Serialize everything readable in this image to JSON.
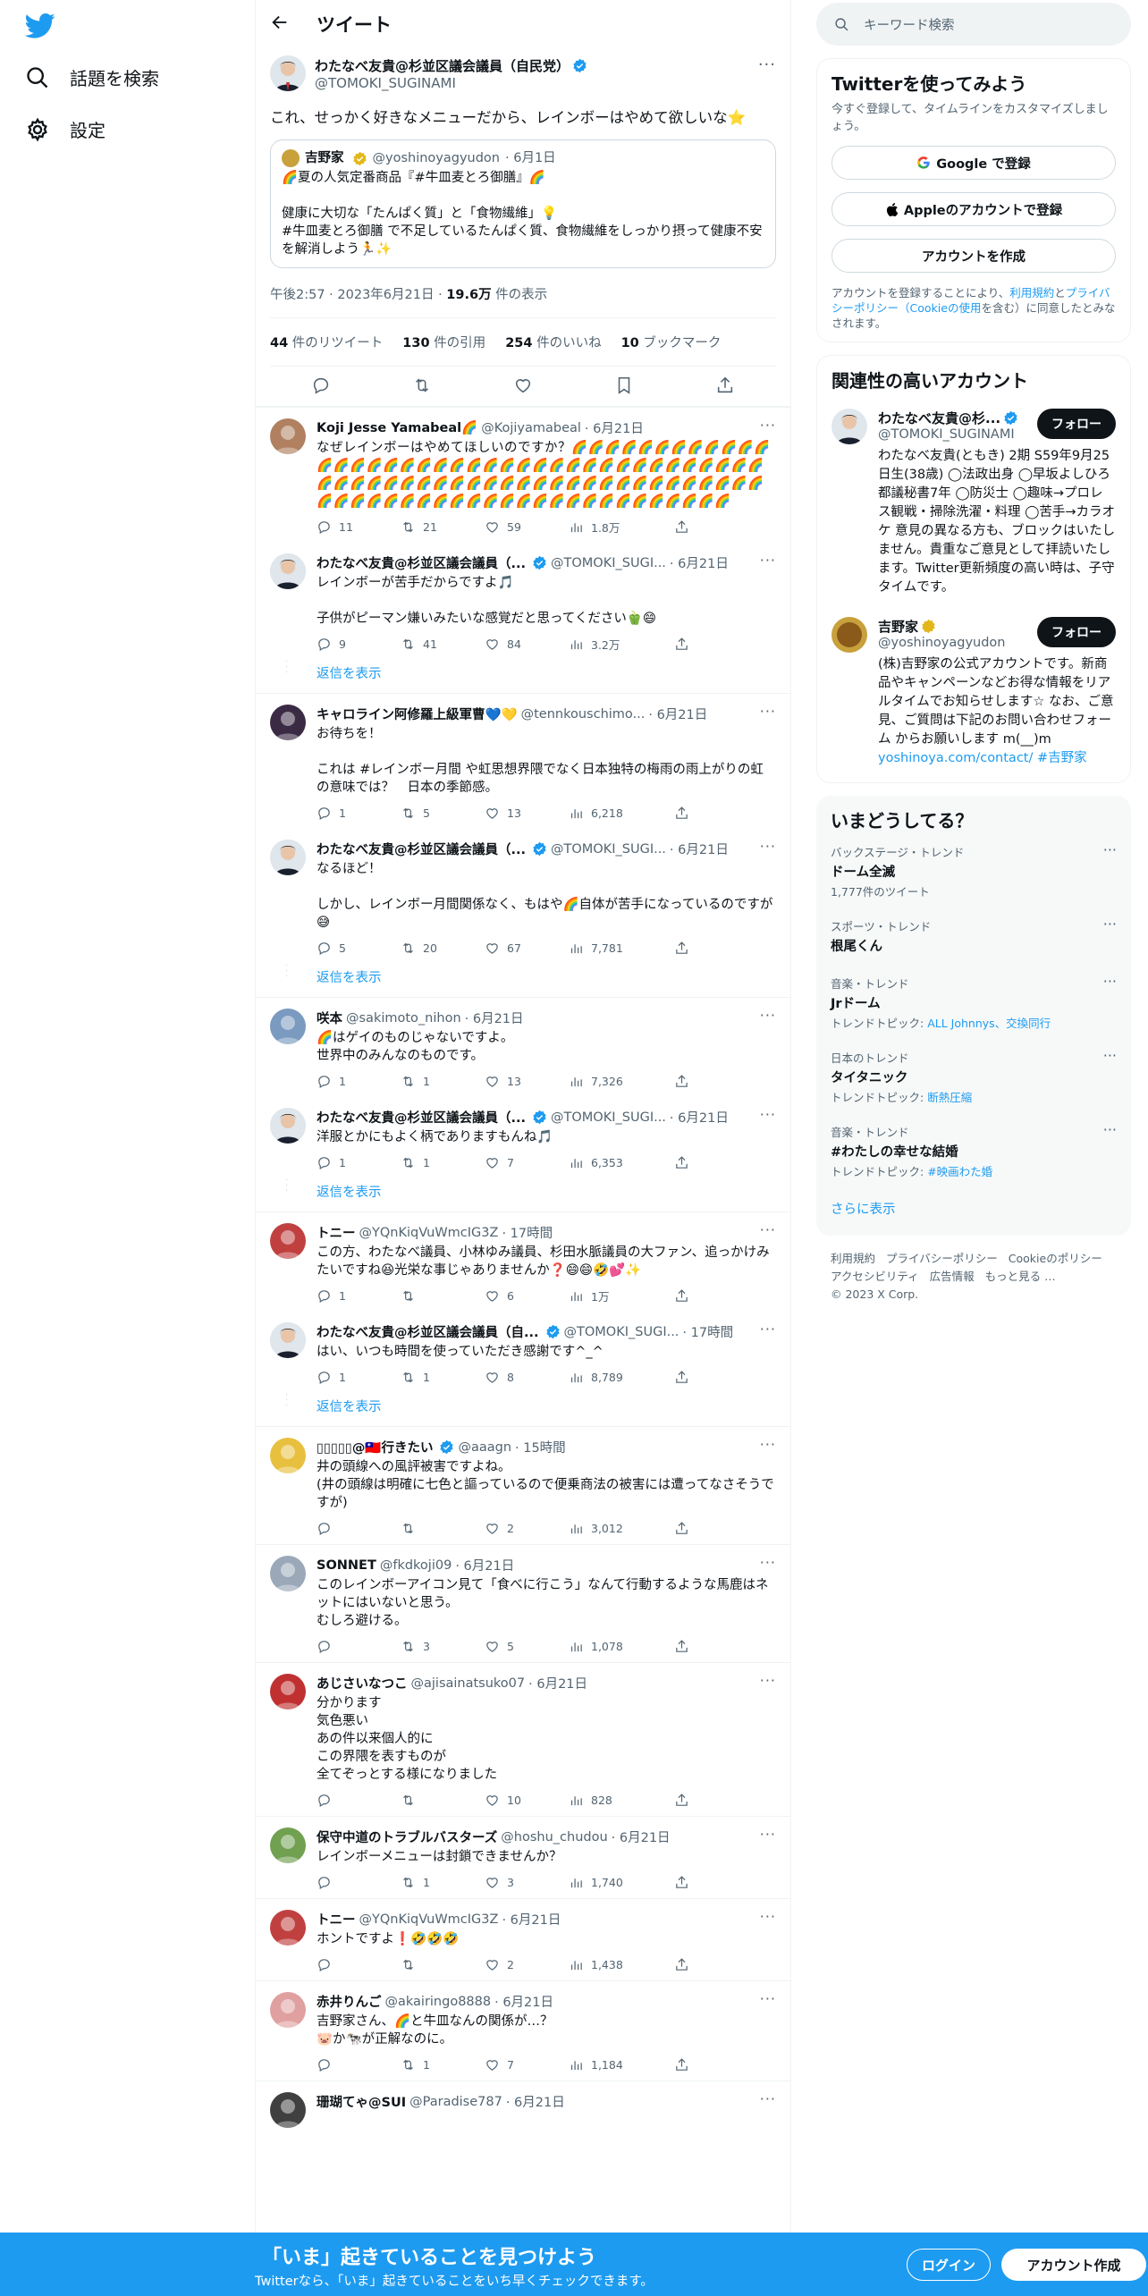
{
  "nav": {
    "explore_label": "話題を検索",
    "settings_label": "設定"
  },
  "header": {
    "title": "ツイート"
  },
  "tweet": {
    "author_name": "わたなべ友貴@杉並区議会議員（自民党）",
    "author_handle": "@TOMOKI_SUGINAMI",
    "text": "これ、せっかく好きなメニューだから、レインボーはやめて欲しいな⭐",
    "quote": {
      "author_name": "吉野家",
      "author_handle": "@yoshinoyagyudon",
      "date": "· 6月1日",
      "line1": "🌈夏の人気定番商品『#牛皿麦とろ御膳』🌈",
      "line2": "健康に大切な「たんぱく質」と「食物繊維」💡",
      "line3": "#牛皿麦とろ御膳 で不足しているたんぱく質、食物繊維をしっかり摂って健康不安を解消しよう🏃✨"
    },
    "time": "午後2:57 · 2023年6月21日 · ",
    "views": "19.6万",
    "views_label": " 件の表示",
    "stats": {
      "retweets": "44",
      "retweets_label": " 件のリツイート",
      "quotes": "130",
      "quotes_label": " 件の引用",
      "likes": "254",
      "likes_label": " 件のいいね",
      "bookmarks": "10",
      "bookmarks_label": " ブックマーク"
    }
  },
  "replies": [
    {
      "name": "Koji Jesse Yamabeal🌈",
      "handle": "@Kojiyamabeal",
      "date": "· 6月21日",
      "text": "なぜレインボーはやめてほしいのですか？🌈🌈🌈🌈🌈🌈🌈🌈🌈🌈🌈🌈🌈🌈🌈🌈🌈🌈🌈🌈🌈🌈🌈🌈🌈🌈🌈🌈🌈🌈🌈🌈🌈🌈🌈🌈🌈🌈🌈🌈🌈🌈🌈🌈🌈🌈🌈🌈🌈🌈🌈🌈🌈🌈🌈🌈🌈🌈🌈🌈🌈🌈🌈🌈🌈🌈🌈🌈🌈🌈🌈🌈🌈🌈🌈🌈🌈🌈🌈🌈🌈🌈🌈🌈🌈🌈🌈🌈🌈🌈🌈",
      "comments": "11",
      "retweets": "21",
      "likes": "59",
      "views": "1.8万"
    },
    {
      "name": "わたなべ友貴@杉並区議会議員（...",
      "handle": "@TOMOKI_SUGI...",
      "date": "· 6月21日",
      "text": "レインボーが苦手だからですよ🎵\n\n子供がピーマン嫌いみたいな感覚だと思ってください🫑😄",
      "comments": "9",
      "retweets": "41",
      "likes": "84",
      "views": "3.2万"
    },
    {
      "name": "キャロライン阿修羅上級軍曹💙💛",
      "handle": "@tennkouschimo...",
      "date": "· 6月21日",
      "text": "お待ちを！\n\nこれは #レインボー月間 や虹思想界隈でなく日本独特の梅雨の雨上がりの虹の意味では？　日本の季節感。",
      "comments": "1",
      "retweets": "5",
      "likes": "13",
      "views": "6,218"
    },
    {
      "name": "わたなべ友貴@杉並区議会議員（...",
      "handle": "@TOMOKI_SUGI...",
      "date": "· 6月21日",
      "text": "なるほど！\n\nしかし、レインボー月間関係なく、もはや🌈自体が苦手になっているのですが😅",
      "comments": "5",
      "retweets": "20",
      "likes": "67",
      "views": "7,781"
    },
    {
      "name": "咲本",
      "handle": "@sakimoto_nihon",
      "date": "· 6月21日",
      "text": "🌈はゲイのものじゃないですよ。\n世界中のみんなのものです。",
      "comments": "1",
      "retweets": "1",
      "likes": "13",
      "views": "7,326"
    },
    {
      "name": "わたなべ友貴@杉並区議会議員（...",
      "handle": "@TOMOKI_SUGI...",
      "date": "· 6月21日",
      "text": "洋服とかにもよく柄でありますもんね🎵",
      "comments": "1",
      "retweets": "1",
      "likes": "7",
      "views": "6,353"
    },
    {
      "name": "トニー",
      "handle": "@YQnKiqVuWmcIG3Z",
      "date": "· 17時間",
      "text": "この方、わたなべ議員、小林ゆみ議員、杉田水脈議員の大ファン、追っかけみたいですね😆光栄な事じゃありませんか❓😄😄🤣💕✨",
      "comments": "1",
      "retweets": "",
      "likes": "6",
      "views": "1万"
    },
    {
      "name": "わたなべ友貴@杉並区議会議員（自...",
      "handle": "@TOMOKI_SUGI...",
      "date": "· 17時間",
      "text": "はい、いつも時間を使っていただき感謝です^_^",
      "comments": "1",
      "retweets": "1",
      "likes": "8",
      "views": "8,789"
    },
    {
      "name": "▯▯▯▯▯@🇹🇼行きたい",
      "handle": "@aaagn",
      "date": "· 15時間",
      "text": "井の頭線への風評被害ですよね。\n(井の頭線は明確に七色と謳っているので便乗商法の被害には遭ってなさそうですが)",
      "comments": "",
      "retweets": "",
      "likes": "2",
      "views": "3,012"
    },
    {
      "name": "SONNET",
      "handle": "@fkdkoji09",
      "date": "· 6月21日",
      "text": "このレインボーアイコン見て「食べに行こう」なんて行動するような馬鹿はネットにはいないと思う。\nむしろ避ける。",
      "comments": "",
      "retweets": "3",
      "likes": "5",
      "views": "1,078"
    },
    {
      "name": "あじさいなつこ",
      "handle": "@ajisainatsuko07",
      "date": "· 6月21日",
      "text": "分かります\n気色悪い\nあの件以来個人的に\nこの界隈を表すものが\n全てぞっとする様になりました",
      "comments": "",
      "retweets": "",
      "likes": "10",
      "views": "828"
    },
    {
      "name": "保守中道のトラブルバスターズ",
      "handle": "@hoshu_chudou",
      "date": "· 6月21日",
      "text": "レインボーメニューは封鎖できませんか？",
      "comments": "",
      "retweets": "1",
      "likes": "3",
      "views": "1,740"
    },
    {
      "name": "トニー",
      "handle": "@YQnKiqVuWmcIG3Z",
      "date": "· 6月21日",
      "text": "ホントですよ❗🤣🤣🤣",
      "comments": "",
      "retweets": "",
      "likes": "2",
      "views": "1,438"
    },
    {
      "name": "赤井りんご",
      "handle": "@akairingo8888",
      "date": "· 6月21日",
      "text": "吉野家さん、🌈と牛皿なんの関係が…？\n🐷か🐄が正解なのに。",
      "comments": "",
      "retweets": "1",
      "likes": "7",
      "views": "1,184"
    },
    {
      "name": "珊瑚てゃ@SUI",
      "handle": "@Paradise787",
      "date": "· 6月21日",
      "text": "",
      "comments": "",
      "retweets": "",
      "likes": "",
      "views": ""
    }
  ],
  "show_replies_label": "返信を表示",
  "right": {
    "search_placeholder": "キーワード検索",
    "signup_card": {
      "title": "Twitterを使ってみよう",
      "subtitle": "今すぐ登録して、タイムラインをカスタマイズしましょう。",
      "google_button": "Google で登録",
      "apple_button": "Appleのアカウントで登録",
      "create_button": "アカウントを作成",
      "legal_pre": "アカウントを登録することにより、",
      "legal_terms": "利用規約",
      "legal_and": "と",
      "legal_privacy": "プライバシーポリシー",
      "legal_cookie": "（Cookieの使用",
      "legal_post": "を含む）に同意したとみなされます。"
    },
    "related": {
      "title": "関連性の高いアカウント",
      "follow_label": "フォロー",
      "accounts": [
        {
          "name": "わたなべ友貴@杉...",
          "handle": "@TOMOKI_SUGINAMI",
          "desc": "わたなべ友貴(ともき) 2期 S59年9月25日生(38歳) ◯法政出身 ◯早坂よしひろ都議秘書7年 ◯防災士 ◯趣味→プロレス観戦・掃除洗濯・料理 ◯苦手→カラオケ 意見の異なる方も、ブロックはいたしません。貴重なご意見として拝読いたします。Twitter更新頻度の高い時は、子守タイムです。",
          "link": ""
        },
        {
          "name": "吉野家",
          "handle": "@yoshinoyagyudon",
          "desc": "(株)吉野家の公式アカウントです。新商品やキャンペーンなどお得な情報をリアルタイムでお知らせします☆ なお、ご意見、ご質問は下記のお問い合わせフォーム からお願いします m(__)m ",
          "link": "yoshinoya.com/contact/ #吉野家"
        }
      ]
    },
    "trends": {
      "title": "いまどうしてる？",
      "items": [
        {
          "category": "バックステージ・トレンド",
          "name": "ドーム全滅",
          "sub": "1,777件のツイート",
          "links": ""
        },
        {
          "category": "スポーツ・トレンド",
          "name": "根尾くん",
          "sub": "",
          "links": ""
        },
        {
          "category": "音楽・トレンド",
          "name": "Jrドーム",
          "sub": "トレンドトピック: ",
          "links": "ALL Johnnys、交換同行"
        },
        {
          "category": "日本のトレンド",
          "name": "タイタニック",
          "sub": "トレンドトピック: ",
          "links": "断熱圧縮"
        },
        {
          "category": "音楽・トレンド",
          "name": "#わたしの幸せな結婚",
          "sub": "トレンドトピック: ",
          "links": "#映画わた婚"
        }
      ],
      "show_more": "さらに表示"
    },
    "footer": [
      "利用規約",
      "プライバシーポリシー",
      "Cookieのポリシー",
      "アクセシビリティ",
      "広告情報",
      "もっと見る …",
      "© 2023 X Corp."
    ]
  },
  "bottom_bar": {
    "title": "「いま」起きていることを見つけよう",
    "subtitle": "Twitterなら、「いま」起きていることをいち早くチェックできます。",
    "login": "ログイン",
    "signup": "アカウント作成"
  },
  "colors": {
    "accent": "#1d9bf0",
    "text": "#0f1419",
    "muted": "#536471",
    "border": "#eff3f4"
  }
}
